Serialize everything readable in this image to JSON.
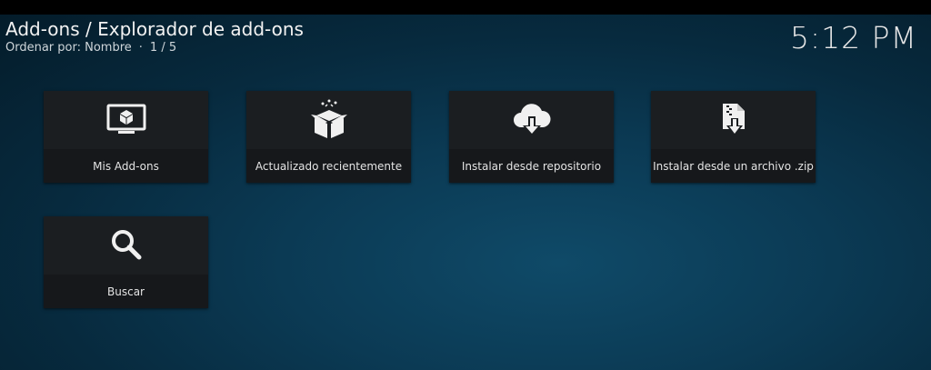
{
  "header": {
    "title": "Add-ons / Explorador de add-ons",
    "sort_label": "Ordenar por: Nombre",
    "separator": "·",
    "page": "1 / 5"
  },
  "clock": "5:12 PM",
  "tiles": [
    {
      "label": "Mis Add-ons",
      "icon": "monitor-box-icon"
    },
    {
      "label": "Actualizado recientemente",
      "icon": "open-box-icon"
    },
    {
      "label": "Instalar desde repositorio",
      "icon": "cloud-download-icon"
    },
    {
      "label": "Instalar desde un archivo .zip",
      "icon": "zip-file-download-icon"
    },
    {
      "label": "Buscar",
      "icon": "search-icon"
    }
  ],
  "colors": {
    "tile_bg": "#1b1e21",
    "label_bg": "#16181b",
    "text": "#e4e4e4",
    "background": "#0b3a54"
  }
}
